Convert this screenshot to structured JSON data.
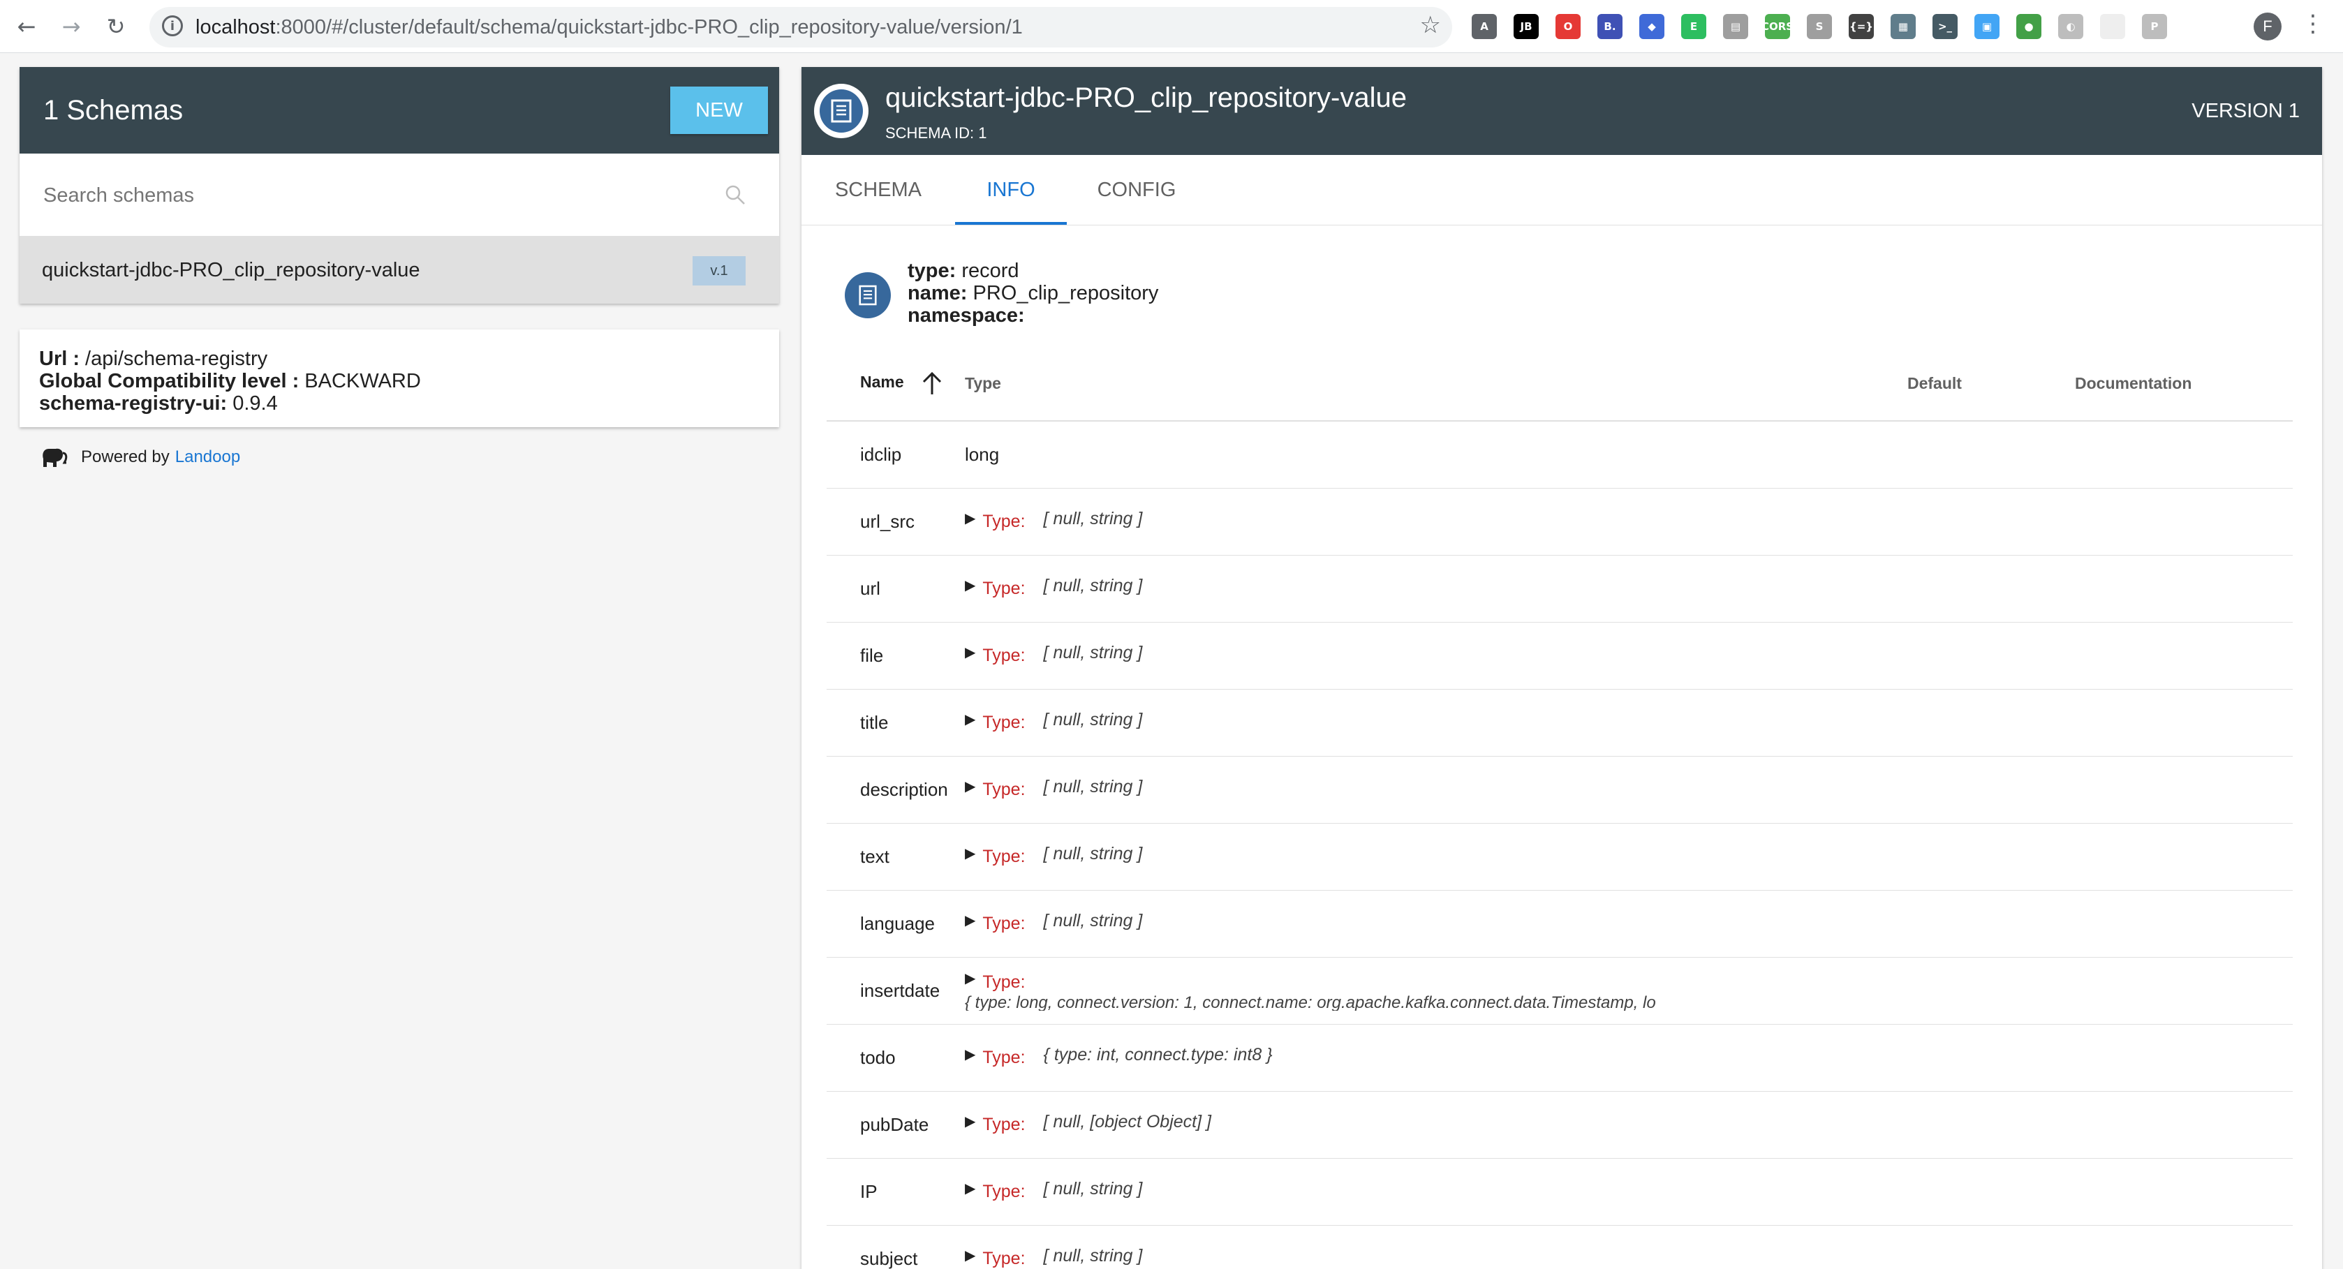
{
  "browser": {
    "url_host": "localhost",
    "url_rest": ":8000/#/cluster/default/schema/quickstart-jdbc-PRO_clip_repository-value/version/1",
    "extensions": [
      {
        "name": "angular-ext-icon",
        "label": "A",
        "color": "#5f6368"
      },
      {
        "name": "jetbrains-ext-icon",
        "label": "JB",
        "color": "#000000"
      },
      {
        "name": "opera-ext-icon",
        "label": "O",
        "color": "#e53935"
      },
      {
        "name": "b-ext-icon",
        "label": "B.",
        "color": "#3f51b5"
      },
      {
        "name": "cap-ext-icon",
        "label": "◆",
        "color": "#3f6ad8"
      },
      {
        "name": "evernote-ext-icon",
        "label": "E",
        "color": "#2dbe60"
      },
      {
        "name": "window-ext-icon",
        "label": "▤",
        "color": "#9e9e9e"
      },
      {
        "name": "cors-ext-icon",
        "label": "CORS",
        "color": "#4caf50"
      },
      {
        "name": "skype-ext-icon",
        "label": "S",
        "color": "#9e9e9e"
      },
      {
        "name": "json-ext-icon",
        "label": "{=}",
        "color": "#424242"
      },
      {
        "name": "doc-ext-icon",
        "label": "▦",
        "color": "#607d8b"
      },
      {
        "name": "terminal-ext-icon",
        "label": ">_",
        "color": "#455a64"
      },
      {
        "name": "grid-ext-icon",
        "label": "▣",
        "color": "#42a5f5"
      },
      {
        "name": "green-ext-icon",
        "label": "●",
        "color": "#43a047"
      },
      {
        "name": "circle-ext-icon",
        "label": "◐",
        "color": "#bdbdbd"
      },
      {
        "name": "blank-ext-icon",
        "label": "",
        "color": "#eeeeee"
      },
      {
        "name": "p-ext-icon",
        "label": "P",
        "color": "#bdbdbd"
      }
    ],
    "profile_initial": "F"
  },
  "left": {
    "title": "1 Schemas",
    "new_label": "NEW",
    "search_placeholder": "Search schemas",
    "schema_item": {
      "name": "quickstart-jdbc-PRO_clip_repository-value",
      "version": "v.1"
    },
    "info": {
      "url_label": "Url :",
      "url_value": " /api/schema-registry",
      "compat_label": "Global Compatibility level :",
      "compat_value": " BACKWARD",
      "ui_label": "schema-registry-ui:",
      "ui_value": " 0.9.4"
    },
    "powered_by": "Powered by",
    "powered_link": "Landoop"
  },
  "right": {
    "title": "quickstart-jdbc-PRO_clip_repository-value",
    "schema_id": "SCHEMA ID: 1",
    "version": "VERSION 1",
    "tabs": [
      "SCHEMA",
      "INFO",
      "CONFIG"
    ],
    "record": {
      "type_label": "type:",
      "type_value": " record",
      "name_label": "name:",
      "name_value": " PRO_clip_repository",
      "namespace_label": "namespace:",
      "namespace_value": ""
    },
    "columns": {
      "name": "Name",
      "type": "Type",
      "default": "Default",
      "doc": "Documentation"
    },
    "type_key": "Type:",
    "fields": [
      {
        "name": "idclip",
        "type": "long",
        "simple": true
      },
      {
        "name": "url_src",
        "type": "[ null, string ]"
      },
      {
        "name": "url",
        "type": "[ null, string ]"
      },
      {
        "name": "file",
        "type": "[ null, string ]"
      },
      {
        "name": "title",
        "type": "[ null, string ]"
      },
      {
        "name": "description",
        "type": "[ null, string ]"
      },
      {
        "name": "text",
        "type": "[ null, string ]"
      },
      {
        "name": "language",
        "type": "[ null, string ]"
      },
      {
        "name": "insertdate",
        "type": "{ type: long, connect.version: 1, connect.name: org.apache.kafka.connect.data.Timestamp, lo",
        "long": true
      },
      {
        "name": "todo",
        "type": "{ type: int, connect.type: int8 }"
      },
      {
        "name": "pubDate",
        "type": "[ null, [object Object] ]"
      },
      {
        "name": "IP",
        "type": "[ null, string ]"
      },
      {
        "name": "subject",
        "type": "[ null, string ]"
      }
    ]
  }
}
